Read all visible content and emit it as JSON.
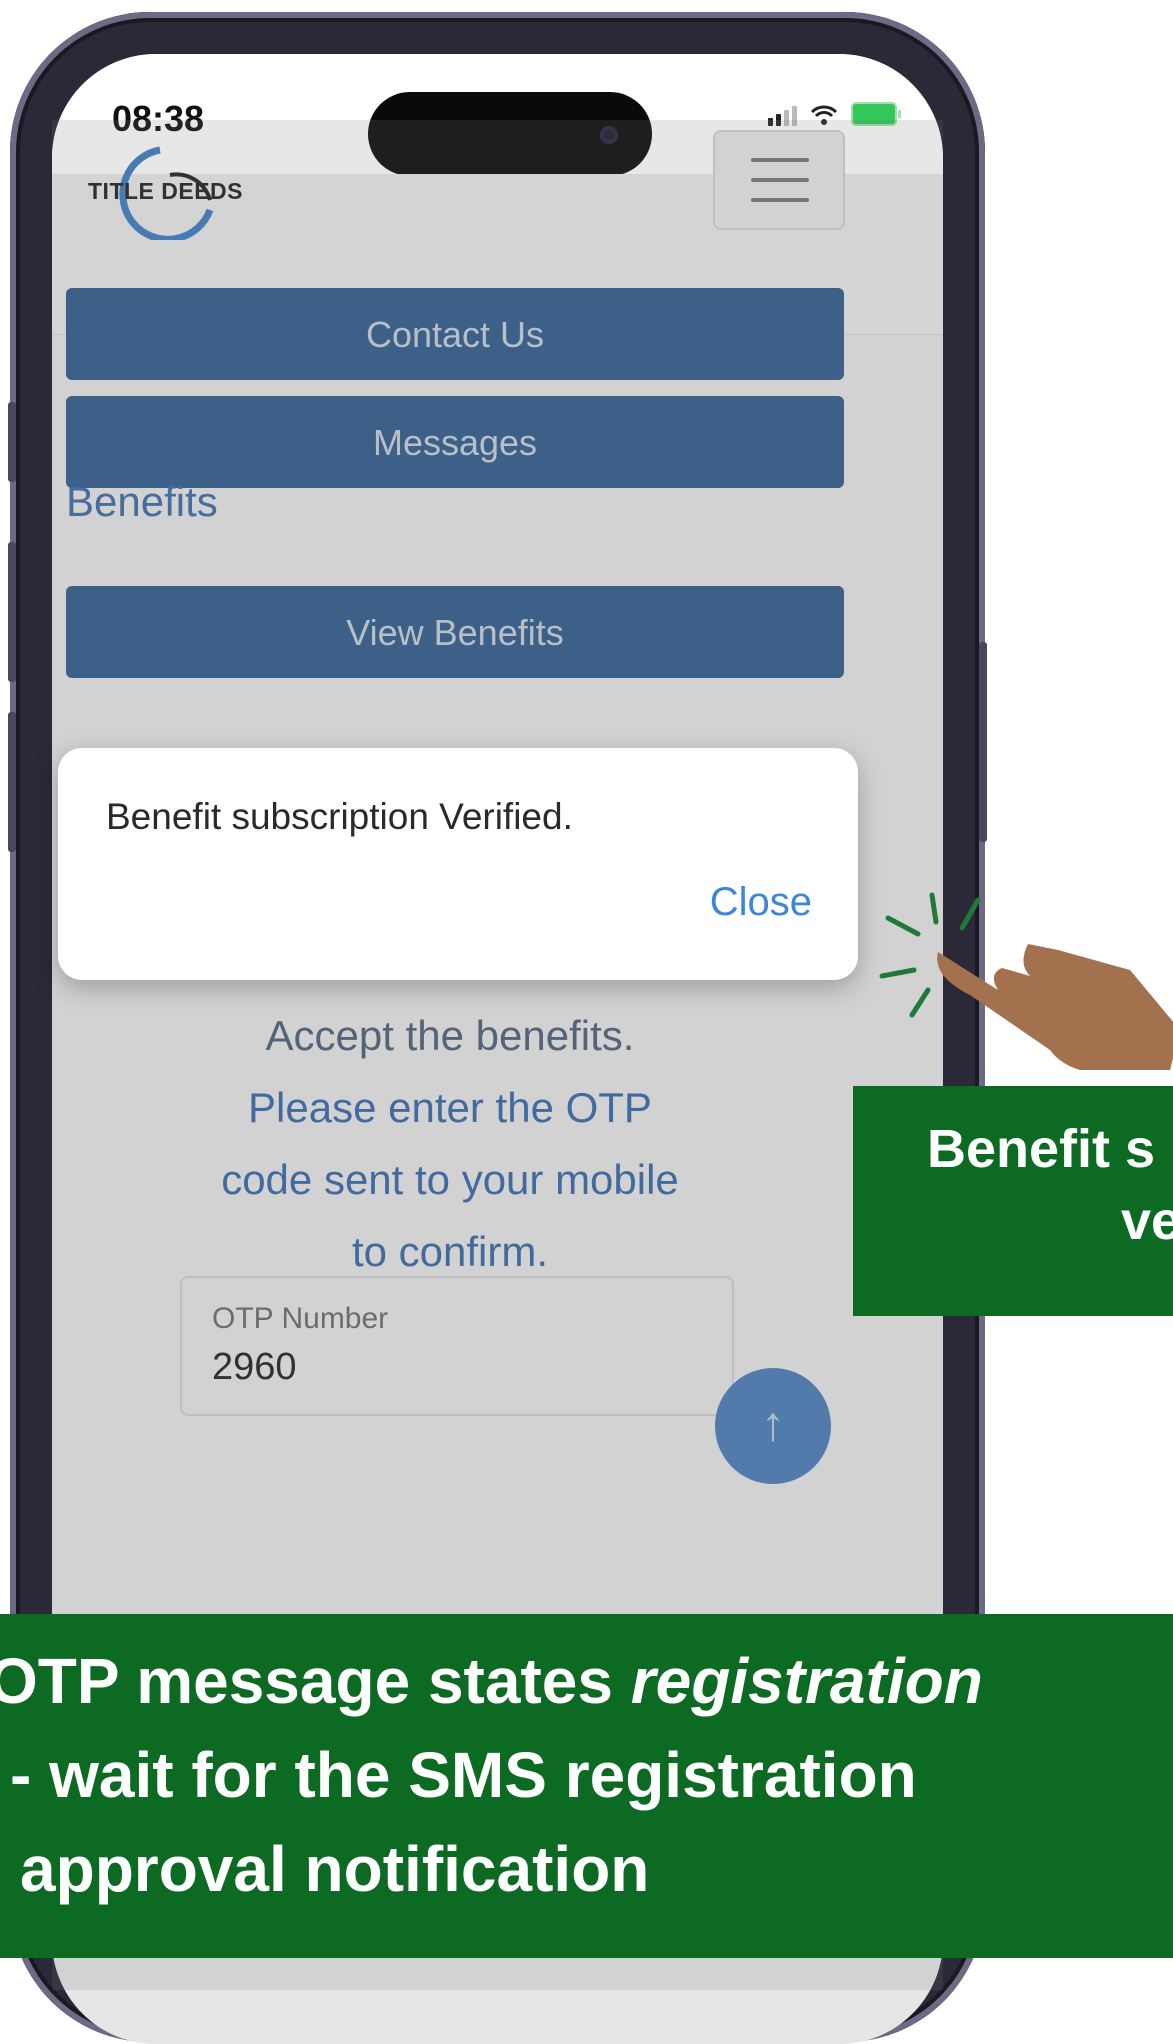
{
  "status_bar": {
    "time": "08:38"
  },
  "header": {
    "logo_text": "TITLE DEEDS",
    "menu_icon": "hamburger-menu-icon"
  },
  "menu": {
    "contact_us": "Contact Us",
    "messages": "Messages",
    "benefits_heading": "Benefits",
    "view_benefits": "View Benefits"
  },
  "otp_section": {
    "line_cut": "Accept the benefits.",
    "line1": "Please enter the OTP",
    "line2": "code sent to your mobile",
    "line3": "to confirm.",
    "field_label": "OTP Number",
    "field_value": "2960",
    "scroll_icon": "arrow-up-icon"
  },
  "dialog": {
    "message": "Benefit subscription Verified.",
    "close_label": "Close"
  },
  "annotations": {
    "right": {
      "line1": "Benefit s",
      "line2": "ve"
    },
    "bottom": {
      "line1_start": "OTP message states ",
      "line1_italic": "registration",
      "line2": "-  wait for the SMS registration",
      "line3": "approval notification"
    },
    "pointer_icon": "pointing-hand-icon",
    "accent_color": "#0c6a22"
  },
  "colors": {
    "button_blue": "#2f5b8a",
    "link_blue": "#3667a8",
    "dialog_close_blue": "#3d86d9"
  }
}
